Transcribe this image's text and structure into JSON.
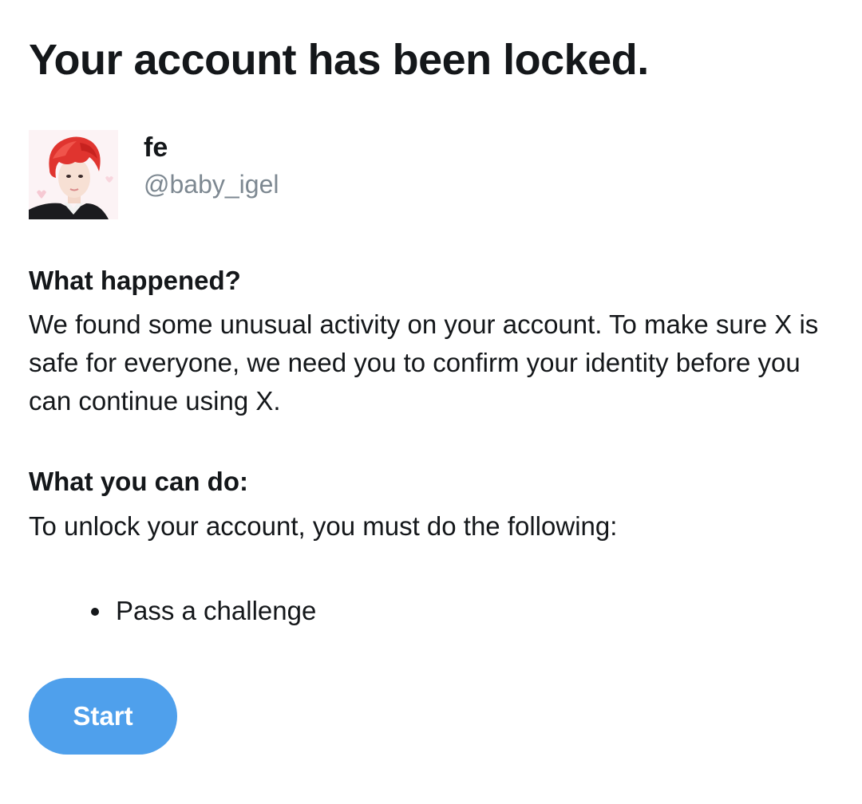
{
  "page": {
    "title": "Your account has been locked."
  },
  "user": {
    "display_name": "fe",
    "handle": "@baby_igel",
    "avatar_icon": "profile-photo"
  },
  "what_happened": {
    "heading": "What happened?",
    "body": "We found some unusual activity on your account. To make sure X is safe for everyone, we need you to confirm your identity before you can continue using X."
  },
  "what_you_can_do": {
    "heading": "What you can do:",
    "body": "To unlock your account, you must do the following:",
    "steps": [
      "Pass a challenge"
    ]
  },
  "actions": {
    "start_label": "Start"
  },
  "colors": {
    "accent": "#4fa0ec",
    "text": "#14171a",
    "secondary_text": "#7d8891",
    "background": "#ffffff"
  }
}
